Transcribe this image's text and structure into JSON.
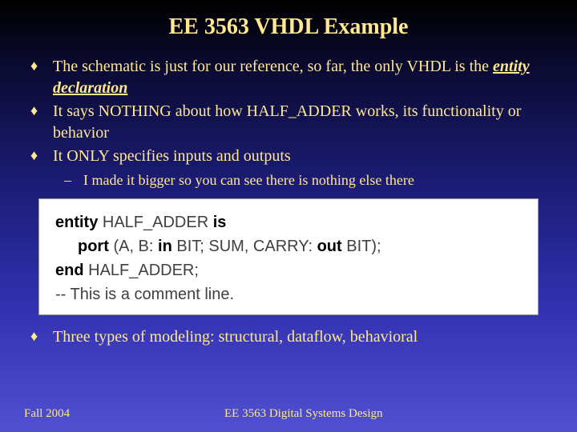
{
  "title": "EE 3563 VHDL Example",
  "bullets": {
    "b1_pre": "The schematic is just for our reference, so far, the only VHDL is the ",
    "b1_emph": "entity declaration",
    "b2": "It says NOTHING about how HALF_ADDER works, its functionality or behavior",
    "b3": "It ONLY specifies inputs and outputs",
    "sub1": "I made it bigger so you can see there is nothing else there",
    "b4": "Three types of modeling:  structural, dataflow, behavioral"
  },
  "code": {
    "l1a": "entity",
    "l1b": " HALF_ADDER ",
    "l1c": "is",
    "l2a": "port",
    "l2b": " (A, B: ",
    "l2c": "in",
    "l2d": " BIT; SUM, CARRY: ",
    "l2e": "out",
    "l2f": " BIT);",
    "l3a": "end",
    "l3b": " HALF_ADDER;",
    "l4": "-- This is a comment line."
  },
  "footer": {
    "left": "Fall 2004",
    "center": "EE 3563 Digital Systems Design"
  },
  "marks": {
    "diamond": "♦",
    "dash": "–"
  }
}
